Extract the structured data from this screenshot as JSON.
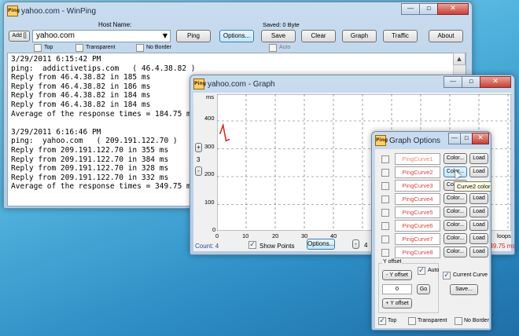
{
  "winping": {
    "title": "yahoo.com - WinPing",
    "host_label": "Host Name:",
    "add_label": "Add []",
    "host_value": "yahoo.com",
    "saved_label": "Saved: 0 Byte",
    "buttons": {
      "ping": "Ping",
      "options": "Options...",
      "save": "Save",
      "clear": "Clear",
      "graph": "Graph",
      "traffic": "Traffic",
      "about": "About"
    },
    "checkboxes": {
      "top": "Top",
      "transparent": "Transparent",
      "no_border": "No Border",
      "auto": "Auto"
    },
    "log": [
      "3/29/2011 6:15:42 PM",
      "ping:  addictivetips.com   ( 46.4.38.82 )",
      "Reply from 46.4.38.82 in 185 ms",
      "Reply from 46.4.38.82 in 186 ms",
      "Reply from 46.4.38.82 in 184 ms",
      "Reply from 46.4.38.82 in 184 ms",
      "Average of the response times = 184.75 ms",
      "",
      "3/29/2011 6:16:46 PM",
      "ping:  yahoo.com   ( 209.191.122.70 )",
      "Reply from 209.191.122.70 in 355 ms",
      "Reply from 209.191.122.70 in 384 ms",
      "Reply from 209.191.122.70 in 328 ms",
      "Reply from 209.191.122.70 in 332 ms",
      "Average of the response times = 349.75 ms"
    ]
  },
  "graph": {
    "title": "yahoo.com - Graph",
    "y_unit": "ms",
    "y_ticks": [
      "400",
      "300",
      "200",
      "100",
      "0"
    ],
    "x_ticks": [
      "0",
      "10",
      "20",
      "30",
      "40"
    ],
    "x_unit": "loops",
    "side_value": "3",
    "plus": "+",
    "minus": "-",
    "count": "Count: 4",
    "show_points": "Show Points",
    "options_button": "Options...",
    "bottom_value": "4",
    "right_value": "349.75 ms",
    "curve_points": [
      355,
      384,
      328,
      332
    ],
    "curve_color": "#e02020"
  },
  "options": {
    "title": "Graph Options",
    "curves": [
      {
        "name": "PingCurve1",
        "color_btn": "Color...",
        "load_btn": "Load"
      },
      {
        "name": "PingCurve2",
        "color_btn": "Color...",
        "load_btn": "Load"
      },
      {
        "name": "PingCurve3",
        "color_btn": "Color...",
        "load_btn": "Load"
      },
      {
        "name": "PingCurve4",
        "color_btn": "Color...",
        "load_btn": "Load"
      },
      {
        "name": "PingCurve5",
        "color_btn": "Color...",
        "load_btn": "Load"
      },
      {
        "name": "PingCurve6",
        "color_btn": "Color...",
        "load_btn": "Load"
      },
      {
        "name": "PingCurve7",
        "color_btn": "Color...",
        "load_btn": "Load"
      },
      {
        "name": "PingCurve8",
        "color_btn": "Color...",
        "load_btn": "Load"
      }
    ],
    "tooltip": "Curve2 color",
    "y_offset_label": "Y offset",
    "minus_offset": "- Y offset",
    "offset_value": "0",
    "go": "Go",
    "plus_offset": "+ Y offset",
    "auto": "Auto",
    "current_curve": "Current Curve",
    "save": "Save...",
    "top": "Top",
    "transparent": "Transparent",
    "no_border": "No Border",
    "check_mark": "✓"
  }
}
